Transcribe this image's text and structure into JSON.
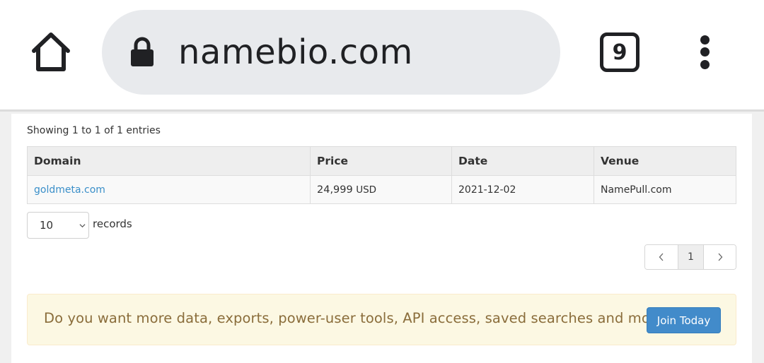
{
  "browser": {
    "url": "namebio.com",
    "tab_count": "9",
    "icons": {
      "home": "home-icon",
      "lock": "lock-icon",
      "tabs": "tab-switcher-icon",
      "menu": "kebab-menu-icon"
    }
  },
  "page": {
    "showing_text": "Showing 1 to 1 of 1 entries",
    "table": {
      "headers": [
        "Domain",
        "Price",
        "Date",
        "Venue"
      ],
      "rows": [
        {
          "domain": "goldmeta.com",
          "price": "24,999",
          "currency": "USD",
          "date": "2021-12-02",
          "venue": "NamePull.com"
        }
      ]
    },
    "records": {
      "selected": "10",
      "label": "records"
    },
    "pagination": {
      "prev": "‹",
      "current": "1",
      "next": "›"
    },
    "promo": {
      "text": "Do you want more data, exports, power-user tools, API access, saved searches and more?",
      "button_label": "Join Today"
    },
    "colors": {
      "link": "#3a8fc9",
      "promo_bg": "#fcf8e3",
      "promo_text": "#8a6d3b",
      "button_bg": "#428bca"
    }
  }
}
